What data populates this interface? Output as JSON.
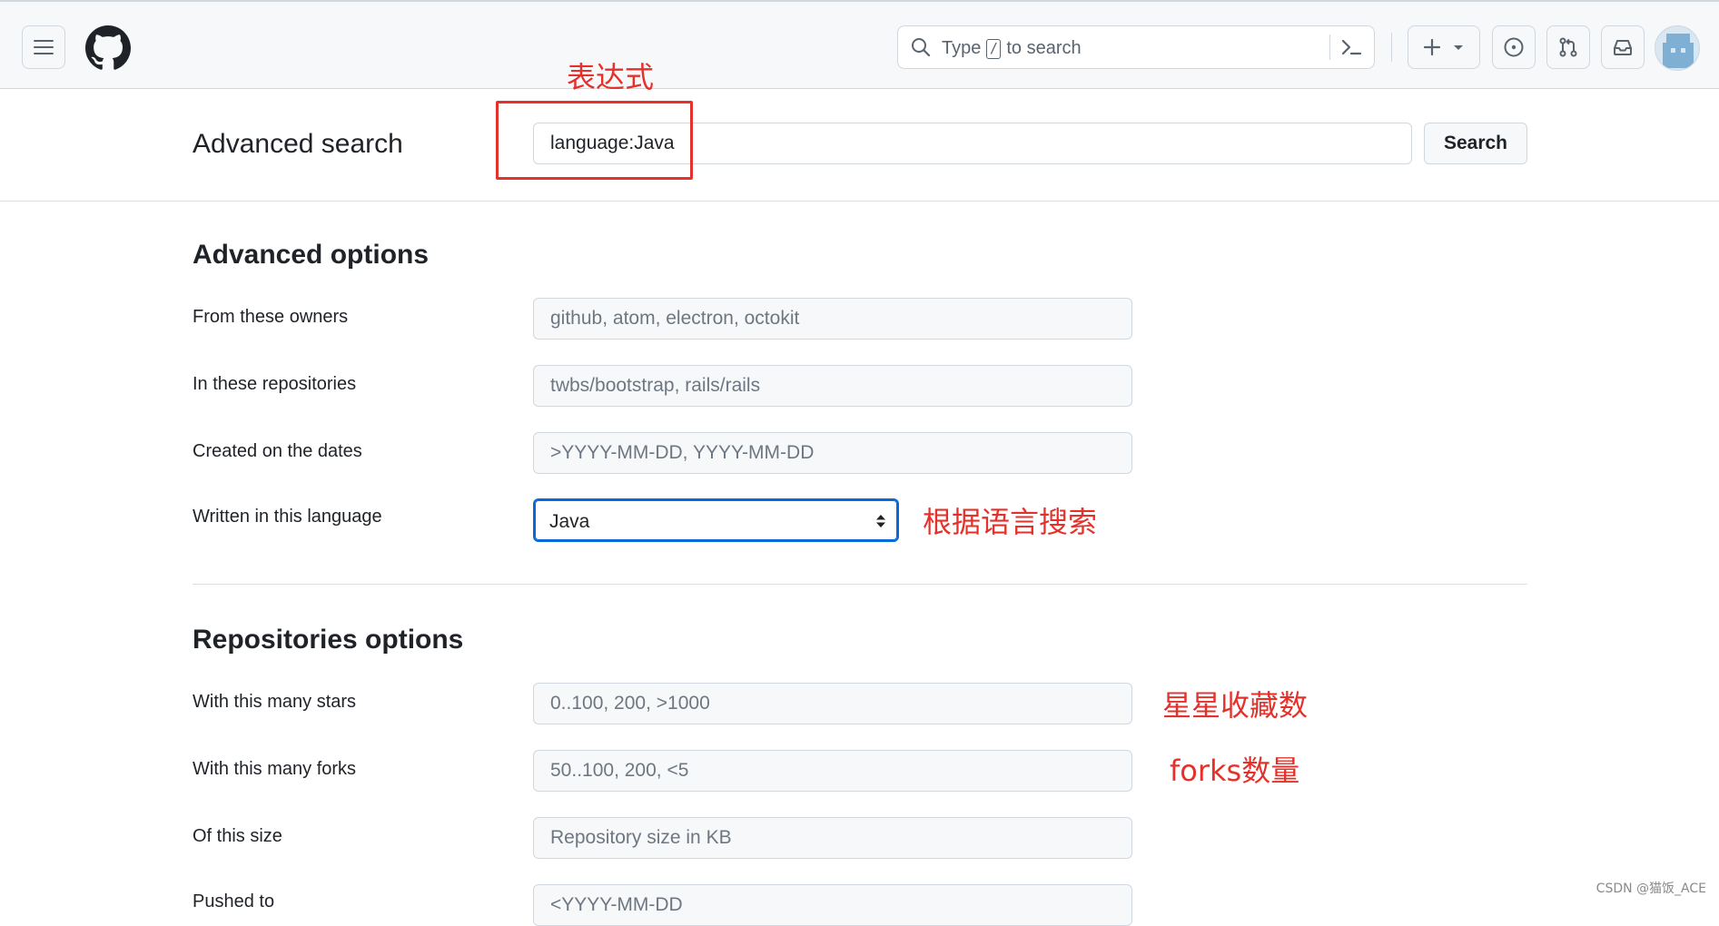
{
  "header": {
    "search_placeholder_pre": "Type",
    "search_placeholder_key": "/",
    "search_placeholder_post": "to search",
    "icons": {
      "menu": "hamburger-menu-icon",
      "logo": "github-octocat-logo",
      "search": "search-icon",
      "command": "command-palette-icon",
      "create": "plus-icon",
      "create_dropdown": "triangle-down-icon",
      "issues": "issue-opened-icon",
      "pulls": "git-pull-request-icon",
      "inbox": "inbox-icon",
      "avatar": "user-avatar"
    }
  },
  "advanced_search": {
    "title": "Advanced search",
    "query_value": "language:Java",
    "search_button": "Search"
  },
  "advanced_options": {
    "title": "Advanced options",
    "rows": [
      {
        "label": "From these owners",
        "placeholder": "github, atom, electron, octokit"
      },
      {
        "label": "In these repositories",
        "placeholder": "twbs/bootstrap, rails/rails"
      },
      {
        "label": "Created on the dates",
        "placeholder": ">YYYY-MM-DD, YYYY-MM-DD"
      }
    ],
    "language_label": "Written in this language",
    "language_selected": "Java"
  },
  "repositories_options": {
    "title": "Repositories options",
    "rows": [
      {
        "label": "With this many stars",
        "placeholder": "0..100, 200, >1000"
      },
      {
        "label": "With this many forks",
        "placeholder": "50..100, 200, <5"
      },
      {
        "label": "Of this size",
        "placeholder": "Repository size in KB"
      },
      {
        "label": "Pushed to",
        "placeholder": "<YYYY-MM-DD"
      }
    ]
  },
  "annotations": {
    "expression": "表达式",
    "by_language": "根据语言搜索",
    "stars": "星星收藏数",
    "forks": "forks数量",
    "color": "#e5312b"
  },
  "watermark": "CSDN @猫饭_ACE",
  "colors": {
    "header_bg": "#f6f8fa",
    "border": "#d0d7de",
    "focus_blue": "#0969da",
    "text": "#1f2328"
  }
}
